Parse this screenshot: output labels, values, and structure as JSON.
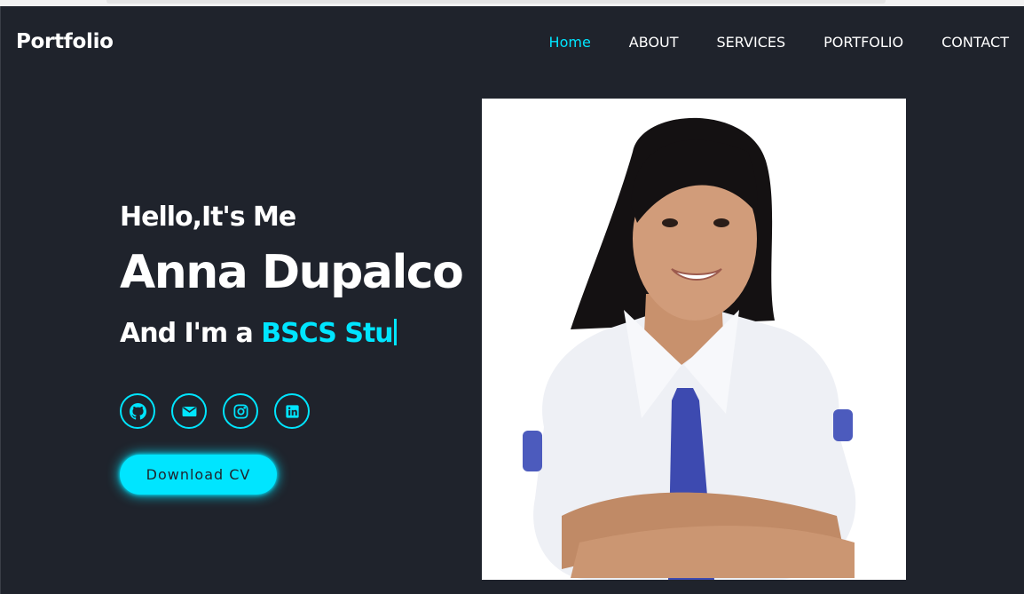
{
  "header": {
    "logo": "Portfolio",
    "nav": [
      {
        "label": "Home",
        "active": true
      },
      {
        "label": "ABOUT",
        "active": false
      },
      {
        "label": "SERVICES",
        "active": false
      },
      {
        "label": "PORTFOLIO",
        "active": false
      },
      {
        "label": "CONTACT",
        "active": false
      }
    ]
  },
  "hero": {
    "greeting": "Hello,It's Me",
    "name": "Anna Dupalco",
    "role_prefix": "And I'm a ",
    "role_typed": "BSCS Stu",
    "socials": [
      {
        "icon": "github-icon"
      },
      {
        "icon": "mail-icon"
      },
      {
        "icon": "instagram-icon"
      },
      {
        "icon": "linkedin-icon"
      }
    ],
    "cta_label": "Download CV"
  },
  "colors": {
    "background": "#1f232c",
    "accent": "#00e5ff",
    "text": "#ffffff"
  }
}
